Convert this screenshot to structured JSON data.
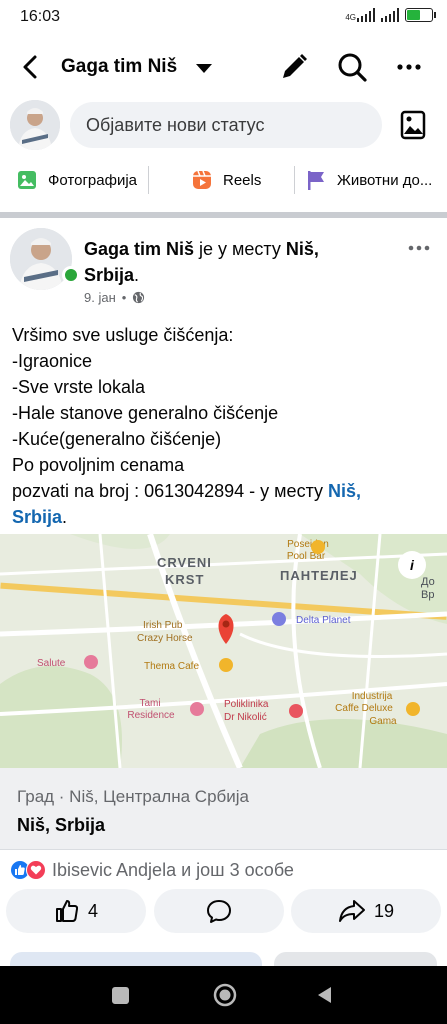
{
  "status_bar": {
    "time": "16:03",
    "network": "4G",
    "battery_percent": 0.55
  },
  "header": {
    "title": "Gaga tim Niš",
    "icons": [
      "back-arrow-icon",
      "caret-down-icon",
      "pencil-icon",
      "search-icon",
      "more-icon"
    ]
  },
  "composer": {
    "placeholder": "Објавите нови статус"
  },
  "quick_actions": [
    {
      "label": "Фотографија",
      "icon": "photo-icon"
    },
    {
      "label": "Reels",
      "icon": "reels-icon"
    },
    {
      "label": "Животни до...",
      "icon": "flag-icon"
    }
  ],
  "post": {
    "author": "Gaga tim Niš",
    "location_prefix": " је у месту ",
    "location_line1": "Niš,",
    "location_line2": "Srbija",
    "location_suffix": ".",
    "date": "9. јан",
    "text_lines": [
      "Vršimo sve usluge čišćenja:",
      "-Igraonice",
      "-Sve vrste lokala",
      "-Hale stanove generalno čišćenje",
      "-Kuće(generalno čišćenje)",
      "Po povoljnim cenama"
    ],
    "last_line_prefix": "pozvati na broj : 0613042894 - у месту ",
    "last_link_1": "Niš,",
    "last_link_2": "Srbija",
    "last_suffix": "."
  },
  "map": {
    "labels": {
      "crveni_krst_1": "CRVENI",
      "crveni_krst_2": "KRST",
      "panteleј": "ПАНТЕЛЕЈ",
      "poseidon_1": "Poseidon",
      "poseidon_2": "Pool Bar",
      "irish_1": "Irish Pub",
      "irish_2": "Crazy Horse",
      "thema": "Thema Cafe",
      "delta": "Delta Planet",
      "salute": "Salute",
      "tami_1": "Tami",
      "tami_2": "Residence",
      "poli_1": "Poliklinika",
      "poli_2": "Dr Nikolić",
      "industrija_1": "Industrija",
      "industrija_2": "Caffe Deluxe",
      "industrija_3": "Gama",
      "edge_1": "До",
      "edge_2": "Вр"
    },
    "info_icon": "i"
  },
  "place_card": {
    "type": "Град · Niš, Централна Србија",
    "name": "Niš, Srbija"
  },
  "reactions": {
    "text": "Ibisevic Andjela и још 3 особе"
  },
  "actions": {
    "like_count": "4",
    "share_count": "19"
  },
  "colors": {
    "link": "#1467b0",
    "like_blue": "#1877f2",
    "love_red": "#f33e58",
    "online_green": "#2aa63a"
  }
}
